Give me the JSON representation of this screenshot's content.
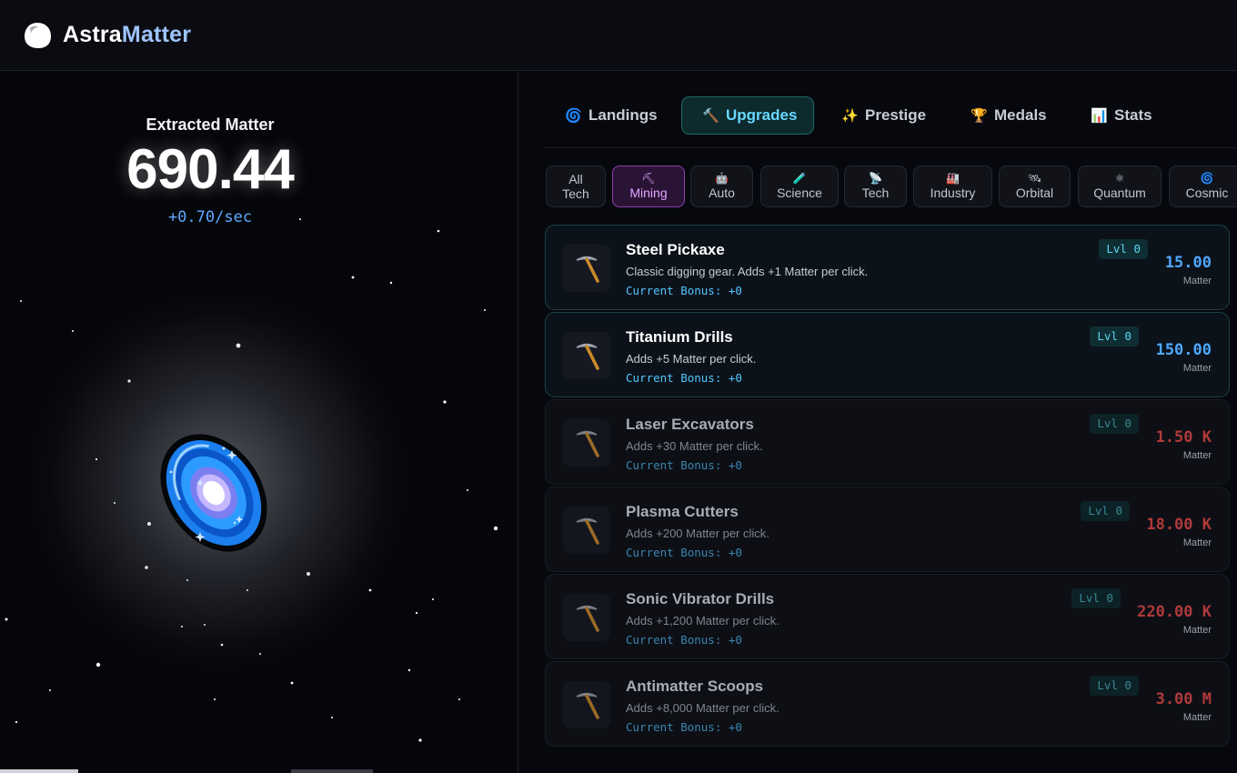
{
  "header": {
    "brand_part1": "Astra",
    "brand_part2": "Matter"
  },
  "stats": {
    "label": "Extracted Matter",
    "value": "690.44",
    "rate": "+0.70/sec"
  },
  "tabs": [
    {
      "label": "Landings",
      "icon": "planet-icon",
      "glyph": "🌀",
      "active": false
    },
    {
      "label": "Upgrades",
      "icon": "wrench-icon",
      "glyph": "🔨",
      "active": true
    },
    {
      "label": "Prestige",
      "icon": "sparkles-icon",
      "glyph": "✨",
      "active": false
    },
    {
      "label": "Medals",
      "icon": "trophy-icon",
      "glyph": "🏆",
      "active": false
    },
    {
      "label": "Stats",
      "icon": "bar-chart-icon",
      "glyph": "📊",
      "active": false
    }
  ],
  "categories": [
    {
      "label": "All Tech",
      "line1": "All",
      "line2": "Tech",
      "glyph": "",
      "icon": "",
      "active": false
    },
    {
      "label": "Mining",
      "line1": "⛏",
      "line2": "Mining",
      "glyph": "⛏",
      "icon": "pickaxe-icon",
      "active": true
    },
    {
      "label": "Auto",
      "line1": "",
      "line2": "Auto",
      "glyph": "🤖",
      "icon": "robot-icon",
      "active": false
    },
    {
      "label": "Science",
      "line1": "",
      "line2": "Science",
      "glyph": "🧪",
      "icon": "test-tube-icon",
      "active": false
    },
    {
      "label": "Tech",
      "line1": "",
      "line2": "Tech",
      "glyph": "📡",
      "icon": "satellite-dish-icon",
      "active": false
    },
    {
      "label": "Industry",
      "line1": "",
      "line2": "Industry",
      "glyph": "🏭",
      "icon": "factory-icon",
      "active": false
    },
    {
      "label": "Orbital",
      "line1": "",
      "line2": "Orbital",
      "glyph": "🛰",
      "icon": "satellite-icon",
      "active": false
    },
    {
      "label": "Quantum",
      "line1": "",
      "line2": "Quantum",
      "glyph": "⚛",
      "icon": "atom-icon",
      "active": false
    },
    {
      "label": "Cosmic",
      "line1": "",
      "line2": "Cosmic",
      "glyph": "🌀",
      "icon": "galaxy-icon",
      "active": false
    }
  ],
  "upgrades": [
    {
      "name": "Steel Pickaxe",
      "desc": "Classic digging gear. Adds +1 Matter per click.",
      "bonus": "Current Bonus: +0",
      "level": "Lvl 0",
      "cost": "15.00",
      "unit": "Matter",
      "affordable": true
    },
    {
      "name": "Titanium Drills",
      "desc": "Adds +5 Matter per click.",
      "bonus": "Current Bonus: +0",
      "level": "Lvl 0",
      "cost": "150.00",
      "unit": "Matter",
      "affordable": true
    },
    {
      "name": "Laser Excavators",
      "desc": "Adds +30 Matter per click.",
      "bonus": "Current Bonus: +0",
      "level": "Lvl 0",
      "cost": "1.50 K",
      "unit": "Matter",
      "affordable": false
    },
    {
      "name": "Plasma Cutters",
      "desc": "Adds +200 Matter per click.",
      "bonus": "Current Bonus: +0",
      "level": "Lvl 0",
      "cost": "18.00 K",
      "unit": "Matter",
      "affordable": false
    },
    {
      "name": "Sonic Vibrator Drills",
      "desc": "Adds +1,200 Matter per click.",
      "bonus": "Current Bonus: +0",
      "level": "Lvl 0",
      "cost": "220.00 K",
      "unit": "Matter",
      "affordable": false
    },
    {
      "name": "Antimatter Scoops",
      "desc": "Adds +8,000 Matter per click.",
      "bonus": "Current Bonus: +0",
      "level": "Lvl 0",
      "cost": "3.00 M",
      "unit": "Matter",
      "affordable": false
    }
  ]
}
